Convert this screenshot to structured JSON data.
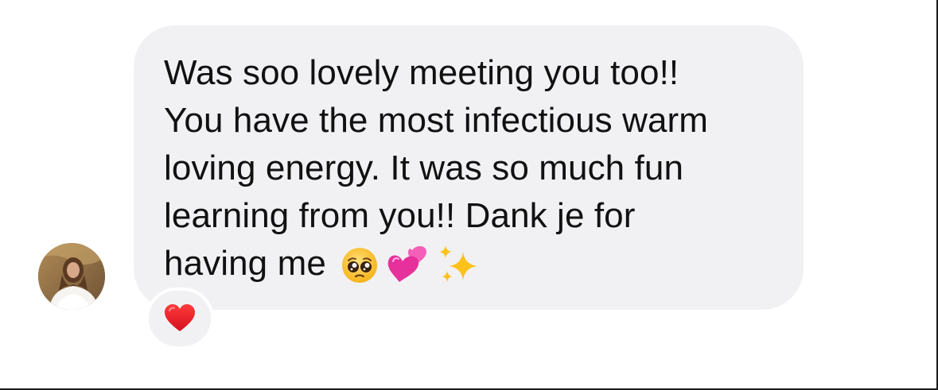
{
  "thread": {
    "message": {
      "lines": [
        "Was soo lovely meeting you too!!",
        "You have the most infectious warm",
        "loving energy. It was so much fun",
        "learning from you!! Dank je for",
        "having me"
      ],
      "trailing_emojis": [
        "pleading-face",
        "two-hearts",
        "sparkles"
      ],
      "bubble_color": "#f1f1f3",
      "text_color": "#111111"
    },
    "sender": {
      "avatar": "profile-photo"
    },
    "reaction": {
      "emoji": "red-heart",
      "color": "#e8202f"
    }
  }
}
